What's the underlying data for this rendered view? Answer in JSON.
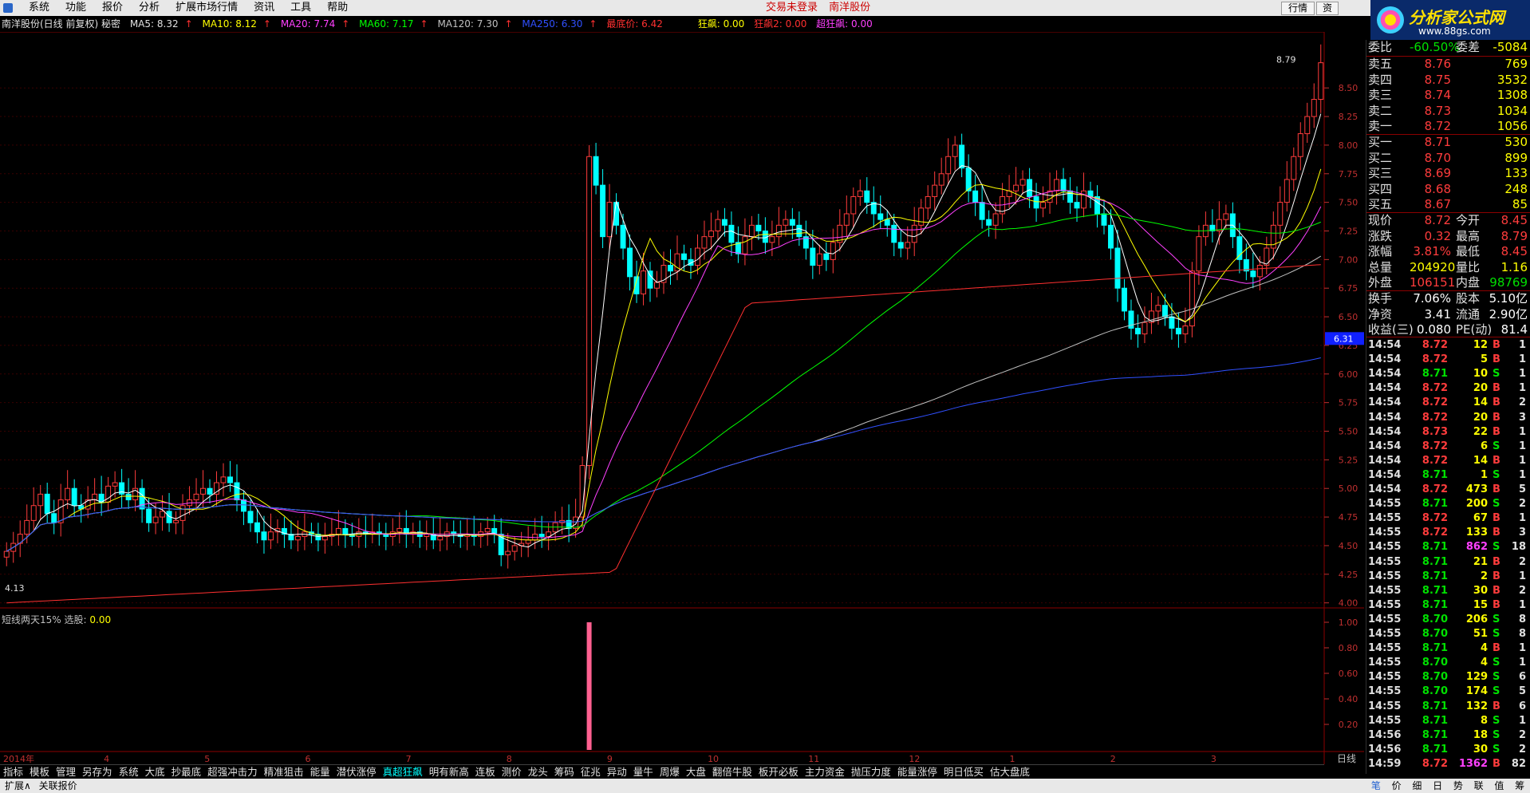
{
  "menubar": {
    "items": [
      "系统",
      "功能",
      "报价",
      "分析",
      "扩展市场行情",
      "资讯",
      "工具",
      "帮助"
    ],
    "status": [
      "交易未登录",
      "南洋股份"
    ],
    "buttons": [
      "行情",
      "资"
    ]
  },
  "brand": {
    "title": "分析家公式网",
    "url": "www.88gs.com"
  },
  "infobar": {
    "stock": "南洋股份(日线 前复权) 秘密",
    "ma5": "MA5: 8.32",
    "ma10": "MA10: 8.12",
    "ma20": "MA20: 7.74",
    "ma60": "MA60: 7.17",
    "ma120": "MA120: 7.30",
    "ma250": "MA250: 6.30",
    "lowest": "最底价: 6.42",
    "wild": "狂飙: 0.00",
    "wild2": "狂飙2: 0.00",
    "superwild": "超狂飙: 0.00",
    "colors": {
      "ma5": "#ffffff",
      "ma10": "#ffff00",
      "ma20": "#ff40ff",
      "ma60": "#00ff00",
      "ma120": "#c0c0c0",
      "ma250": "#3050ff",
      "lowest": "#ff3030"
    }
  },
  "chart_data": {
    "type": "candlestick",
    "yaxis_ticks": [
      "8.50",
      "8.25",
      "8.00",
      "7.75",
      "7.50",
      "7.25",
      "7.00",
      "6.75",
      "6.50",
      "6.25",
      "6.00",
      "5.75",
      "5.50",
      "5.25",
      "5.00",
      "4.75",
      "4.50",
      "4.25",
      "4.00"
    ],
    "ylim": [
      3.9,
      8.85
    ],
    "price_marker": "6.31",
    "annotations": {
      "high": "8.79",
      "low": "4.13"
    },
    "month_labels": [
      "2014年",
      "4",
      "5",
      "6",
      "7",
      "8",
      "9",
      "10",
      "11",
      "12",
      "1",
      "2",
      "3"
    ],
    "closes": [
      4.45,
      4.52,
      4.6,
      4.72,
      4.85,
      4.95,
      4.78,
      4.7,
      4.9,
      5.0,
      4.85,
      4.82,
      4.9,
      4.95,
      4.88,
      5.02,
      5.05,
      4.95,
      4.9,
      5.0,
      4.82,
      4.7,
      4.75,
      4.8,
      4.7,
      4.72,
      4.85,
      4.9,
      4.95,
      5.0,
      4.95,
      5.05,
      5.1,
      5.05,
      4.9,
      4.8,
      4.7,
      4.62,
      4.55,
      4.62,
      4.65,
      4.6,
      4.55,
      4.58,
      4.62,
      4.6,
      4.55,
      4.58,
      4.6,
      4.65,
      4.6,
      4.58,
      4.62,
      4.6,
      4.62,
      4.6,
      4.58,
      4.62,
      4.65,
      4.6,
      4.62,
      4.58,
      4.6,
      4.55,
      4.58,
      4.62,
      4.6,
      4.58,
      4.6,
      4.58,
      4.62,
      4.65,
      4.6,
      4.42,
      4.45,
      4.5,
      4.52,
      4.55,
      4.6,
      4.58,
      4.62,
      4.7,
      4.72,
      4.65,
      4.75,
      5.2,
      7.9,
      7.65,
      7.2,
      7.5,
      7.3,
      7.1,
      6.85,
      6.7,
      6.9,
      6.75,
      6.8,
      6.95,
      6.9,
      7.05,
      7.0,
      6.95,
      7.1,
      7.2,
      7.25,
      7.35,
      7.3,
      7.15,
      7.05,
      7.2,
      7.3,
      7.25,
      7.15,
      7.2,
      7.3,
      7.35,
      7.3,
      7.2,
      7.1,
      6.95,
      7.05,
      7.0,
      7.15,
      7.3,
      7.4,
      7.55,
      7.6,
      7.5,
      7.4,
      7.35,
      7.3,
      7.15,
      7.1,
      7.15,
      7.3,
      7.45,
      7.55,
      7.65,
      7.75,
      7.9,
      8.0,
      7.8,
      7.6,
      7.5,
      7.35,
      7.3,
      7.4,
      7.55,
      7.6,
      7.65,
      7.7,
      7.55,
      7.45,
      7.5,
      7.6,
      7.7,
      7.6,
      7.5,
      7.45,
      7.6,
      7.55,
      7.4,
      7.3,
      7.1,
      6.75,
      6.55,
      6.4,
      6.35,
      6.45,
      6.55,
      6.6,
      6.5,
      6.4,
      6.35,
      6.42,
      6.9,
      7.2,
      7.3,
      7.25,
      7.35,
      7.4,
      7.2,
      7.0,
      6.9,
      6.85,
      6.95,
      7.1,
      7.3,
      7.5,
      7.7,
      7.9,
      8.1,
      8.25,
      8.4,
      8.72
    ],
    "lower_indicator": {
      "title": "短线两天15%",
      "select_label": "选股",
      "select_value": "0.00",
      "yticks": [
        "1.00",
        "0.80",
        "0.60",
        "0.40",
        "0.20"
      ],
      "signal_index": 86
    }
  },
  "tabs": [
    "指标",
    "模板",
    "管理",
    "另存为",
    "系统",
    "大底",
    "抄最底",
    "超强冲击力",
    "精准狙击",
    "能量",
    "潜伏涨停",
    "真超狂飙",
    "明有新高",
    "连板",
    "测价",
    "龙头",
    "筹码",
    "征兆",
    "异动",
    "量牛",
    "周爆",
    "大盘",
    "翻倍牛股",
    "板开必板",
    "主力资金",
    "抛压力度",
    "能量涨停",
    "明日低买",
    "估大盘底"
  ],
  "active_tab": "真超狂飙",
  "period": "日线",
  "bottombar": {
    "left": "扩展∧",
    "right": "关联报价"
  },
  "quote": {
    "header": {
      "l1": "委比",
      "v1": "-60.50%",
      "l2": "委差",
      "v2": "-5084"
    },
    "sells": [
      [
        "卖五",
        "8.76",
        "769"
      ],
      [
        "卖四",
        "8.75",
        "3532"
      ],
      [
        "卖三",
        "8.74",
        "1308"
      ],
      [
        "卖二",
        "8.73",
        "1034"
      ],
      [
        "卖一",
        "8.72",
        "1056"
      ]
    ],
    "buys": [
      [
        "买一",
        "8.71",
        "530"
      ],
      [
        "买二",
        "8.70",
        "899"
      ],
      [
        "买三",
        "8.69",
        "133"
      ],
      [
        "买四",
        "8.68",
        "248"
      ],
      [
        "买五",
        "8.67",
        "85"
      ]
    ],
    "stats": [
      [
        "现价",
        "8.72",
        "今开",
        "8.45"
      ],
      [
        "涨跌",
        "0.32",
        "最高",
        "8.79"
      ],
      [
        "涨幅",
        "3.81%",
        "最低",
        "8.45"
      ],
      [
        "总量",
        "204920",
        "量比",
        "1.16"
      ],
      [
        "外盘",
        "106151",
        "内盘",
        "98769"
      ]
    ],
    "fund": [
      [
        "换手",
        "7.06%",
        "股本",
        "5.10亿"
      ],
      [
        "净资",
        "3.41",
        "流通",
        "2.90亿"
      ],
      [
        "收益(三)",
        "0.080",
        "PE(动)",
        "81.4"
      ]
    ]
  },
  "ticks": [
    [
      "14:54",
      "8.72",
      "12",
      "B",
      "1"
    ],
    [
      "14:54",
      "8.72",
      "5",
      "B",
      "1"
    ],
    [
      "14:54",
      "8.71",
      "10",
      "S",
      "1"
    ],
    [
      "14:54",
      "8.72",
      "20",
      "B",
      "1"
    ],
    [
      "14:54",
      "8.72",
      "14",
      "B",
      "2"
    ],
    [
      "14:54",
      "8.72",
      "20",
      "B",
      "3"
    ],
    [
      "14:54",
      "8.73",
      "22",
      "B",
      "1"
    ],
    [
      "14:54",
      "8.72",
      "6",
      "S",
      "1"
    ],
    [
      "14:54",
      "8.72",
      "14",
      "B",
      "1"
    ],
    [
      "14:54",
      "8.71",
      "1",
      "S",
      "1"
    ],
    [
      "14:54",
      "8.72",
      "473",
      "B",
      "5"
    ],
    [
      "14:55",
      "8.71",
      "200",
      "S",
      "2"
    ],
    [
      "14:55",
      "8.72",
      "67",
      "B",
      "1"
    ],
    [
      "14:55",
      "8.72",
      "133",
      "B",
      "3"
    ],
    [
      "14:55",
      "8.71",
      "862",
      "S",
      "18"
    ],
    [
      "14:55",
      "8.71",
      "21",
      "B",
      "2"
    ],
    [
      "14:55",
      "8.71",
      "2",
      "B",
      "1"
    ],
    [
      "14:55",
      "8.71",
      "30",
      "B",
      "2"
    ],
    [
      "14:55",
      "8.71",
      "15",
      "B",
      "1"
    ],
    [
      "14:55",
      "8.70",
      "206",
      "S",
      "8"
    ],
    [
      "14:55",
      "8.70",
      "51",
      "S",
      "8"
    ],
    [
      "14:55",
      "8.71",
      "4",
      "B",
      "1"
    ],
    [
      "14:55",
      "8.70",
      "4",
      "S",
      "1"
    ],
    [
      "14:55",
      "8.70",
      "129",
      "S",
      "6"
    ],
    [
      "14:55",
      "8.70",
      "174",
      "S",
      "5"
    ],
    [
      "14:55",
      "8.71",
      "132",
      "B",
      "6"
    ],
    [
      "14:55",
      "8.71",
      "8",
      "S",
      "1"
    ],
    [
      "14:56",
      "8.71",
      "18",
      "S",
      "2"
    ],
    [
      "14:56",
      "8.71",
      "30",
      "S",
      "2"
    ],
    [
      "14:59",
      "8.72",
      "1362",
      "B",
      "82"
    ]
  ],
  "rtabs": [
    "笔",
    "价",
    "细",
    "日",
    "势",
    "联",
    "值",
    "筹"
  ]
}
